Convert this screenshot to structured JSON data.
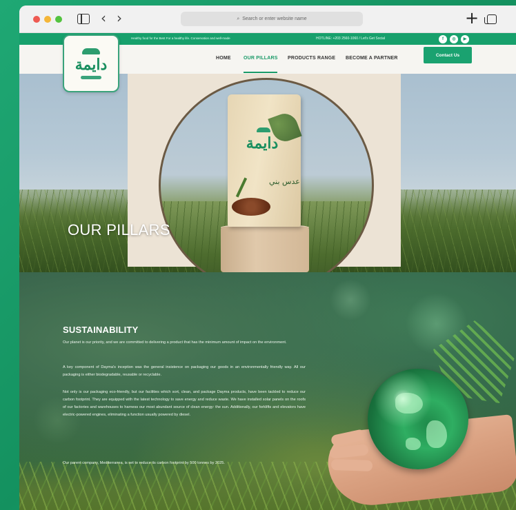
{
  "browser": {
    "url_placeholder": "Search or enter website name",
    "back_glyph": "‹",
    "forward_glyph": "›",
    "new_tab_glyph": "+"
  },
  "topbar": {
    "tagline": "Healthy food for the Best For a healthy life. Conservation and well-made",
    "hotline": "HOTLINE: +203 2560-1060 / Let's Get Social",
    "social_icons": [
      "facebook-icon",
      "instagram-icon",
      "youtube-icon"
    ],
    "social_glyphs": [
      "f",
      "◎",
      "▶"
    ]
  },
  "logo": {
    "wordmark": "دايمة"
  },
  "nav": {
    "items": [
      {
        "label": "HOME"
      },
      {
        "label": "OUR PILLARS"
      },
      {
        "label": "PRODUCTS RANGE"
      },
      {
        "label": "BECOME A PARTNER"
      }
    ],
    "active_index": 1,
    "contact_label": "Contact Us"
  },
  "hero": {
    "title": "OUR PILLARS",
    "product": {
      "brand": "دايمة",
      "label": "عدس بني"
    }
  },
  "section": {
    "title": "SUSTAINABILITY",
    "paragraphs": [
      "Our planet is our priority, and we are committed to delivering a product that has the minimum amount of impact on the environment.",
      "A key component of Dayma's inception was the general insistence on packaging our goods in an environmentally friendly way. All our packaging is either biodegradable, reusable or recyclable.",
      "Not only is our packaging eco-friendly, but our facilities which sort, clean, and package Dayma products, have been tackled to reduce our carbon footprint. They are equipped with the latest technology to save energy and reduce waste. We have installed solar panels on the roofs of our factories and warehouses to harness our most abundant source of clean energy: the sun. Additionally, our forklifts and elevators have electric-powered engines, eliminating a function usually powered by diesel.",
      "Our parent company, Mediterranea, is set to reduce its carbon footprint by 500 tonnes by 2025."
    ]
  },
  "colors": {
    "brand_green": "#1aa270",
    "outer_background": "#17a06c"
  }
}
